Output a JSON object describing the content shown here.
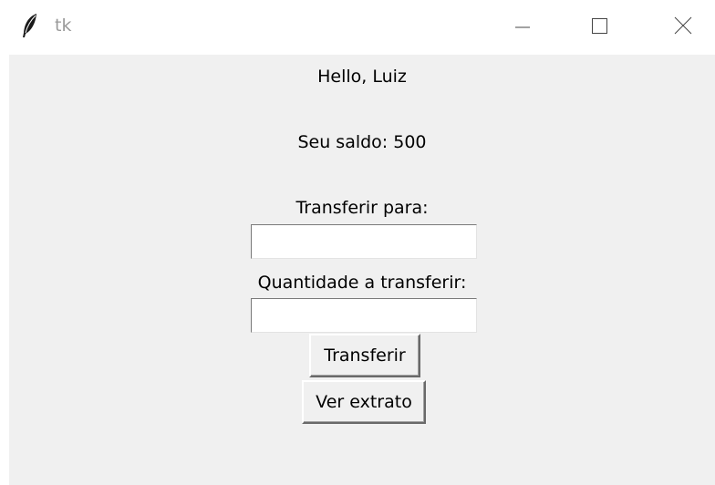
{
  "window": {
    "title": "tk",
    "icon": "feather-icon",
    "controls": {
      "minimize_icon": "minimize-icon",
      "maximize_icon": "maximize-icon",
      "close_icon": "close-icon"
    }
  },
  "main": {
    "greeting": "Hello, Luiz",
    "balance": "Seu saldo: 500",
    "transfer_to_label": "Transferir para:",
    "transfer_to_value": "",
    "amount_label": "Quantidade a transferir:",
    "amount_value": "",
    "transfer_button": "Transferir",
    "statement_button": "Ver extrato"
  }
}
